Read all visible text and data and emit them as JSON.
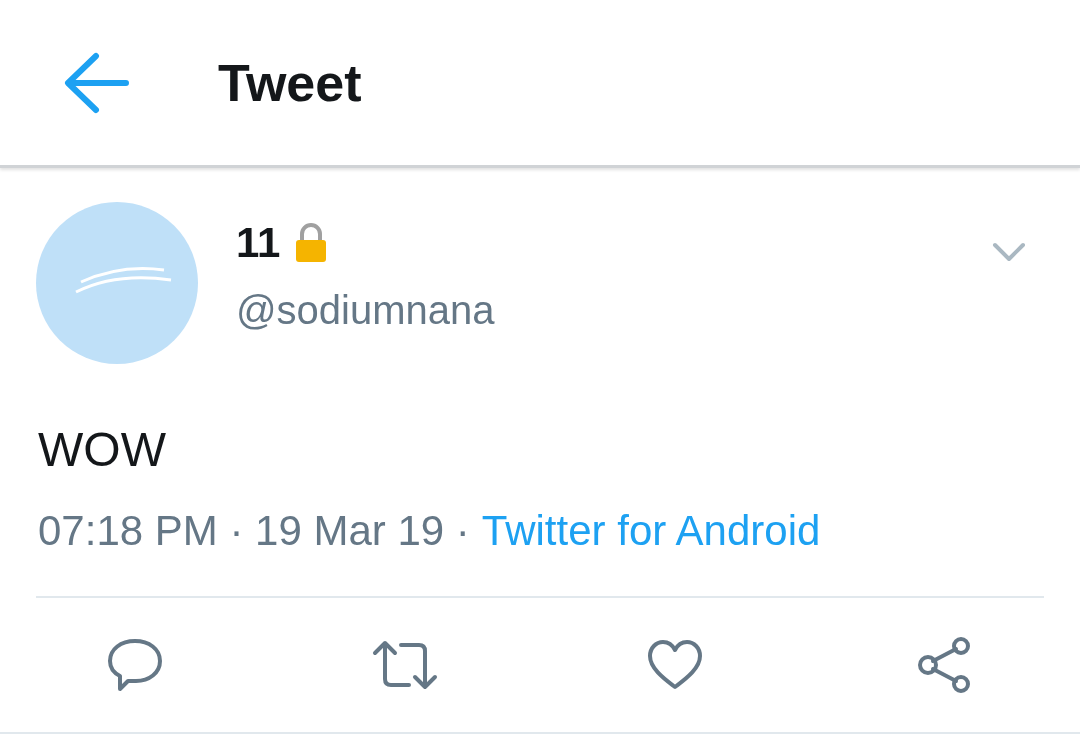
{
  "header": {
    "title": "Tweet"
  },
  "tweet": {
    "name": "11",
    "handle": "@sodiumnana",
    "text": "WOW",
    "timestamp": "07:18 PM · 19 Mar 19 ·",
    "source": "Twitter for Android"
  },
  "actions": [
    {
      "kind": "reply"
    },
    {
      "kind": "retweet"
    },
    {
      "kind": "like"
    },
    {
      "kind": "share"
    }
  ]
}
